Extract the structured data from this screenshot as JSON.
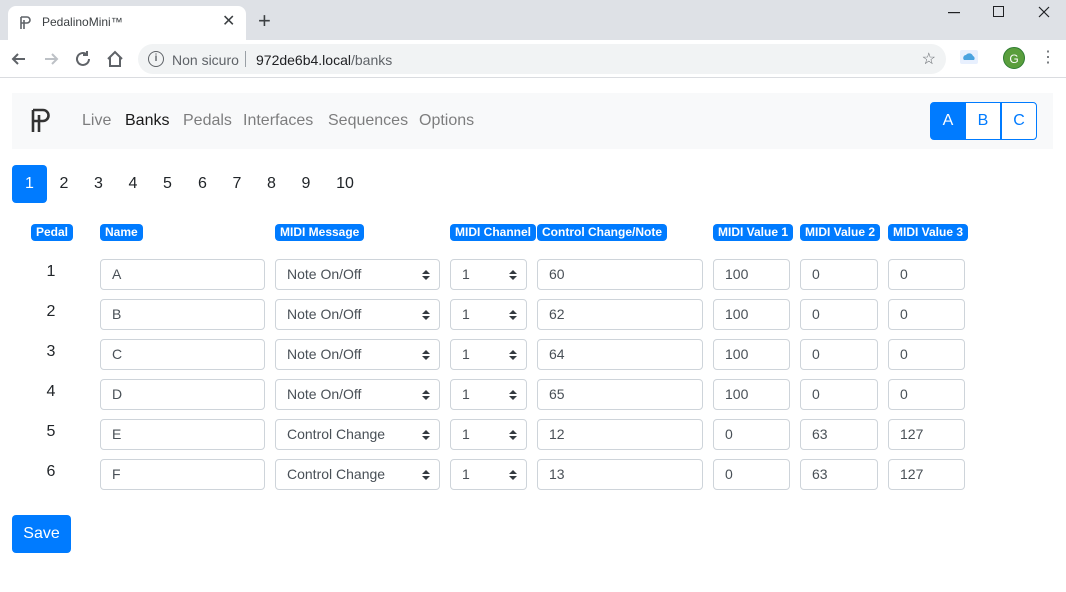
{
  "browser": {
    "tab_title": "PedalinoMini™",
    "newtab": "+",
    "close": "✕",
    "security": "Non sicuro",
    "url_host": "972de6b4.local",
    "url_path": "/banks",
    "avatar_letter": "G"
  },
  "nav": {
    "links": [
      "Live",
      "Banks",
      "Pedals",
      "Interfaces",
      "Sequences",
      "Options"
    ],
    "active_link": "Banks",
    "banks": [
      "A",
      "B",
      "C"
    ],
    "active_bank": "A"
  },
  "pagination": [
    "1",
    "2",
    "3",
    "4",
    "5",
    "6",
    "7",
    "8",
    "9",
    "10"
  ],
  "table": {
    "headers": {
      "pedal": "Pedal",
      "name": "Name",
      "message": "MIDI Message",
      "channel": "MIDI Channel",
      "cc": "Control Change/Note",
      "v1": "MIDI Value 1",
      "v2": "MIDI Value 2",
      "v3": "MIDI Value 3"
    },
    "rows": [
      {
        "pedal": "1",
        "name": "A",
        "message": "Note On/Off",
        "channel": "1",
        "cc": "60",
        "v1": "100",
        "v2": "0",
        "v3": "0"
      },
      {
        "pedal": "2",
        "name": "B",
        "message": "Note On/Off",
        "channel": "1",
        "cc": "62",
        "v1": "100",
        "v2": "0",
        "v3": "0"
      },
      {
        "pedal": "3",
        "name": "C",
        "message": "Note On/Off",
        "channel": "1",
        "cc": "64",
        "v1": "100",
        "v2": "0",
        "v3": "0"
      },
      {
        "pedal": "4",
        "name": "D",
        "message": "Note On/Off",
        "channel": "1",
        "cc": "65",
        "v1": "100",
        "v2": "0",
        "v3": "0"
      },
      {
        "pedal": "5",
        "name": "E",
        "message": "Control Change",
        "channel": "1",
        "cc": "12",
        "v1": "0",
        "v2": "63",
        "v3": "127"
      },
      {
        "pedal": "6",
        "name": "F",
        "message": "Control Change",
        "channel": "1",
        "cc": "13",
        "v1": "0",
        "v2": "63",
        "v3": "127"
      }
    ]
  },
  "save_label": "Save",
  "colors": {
    "primary": "#007bff",
    "navbar_bg": "#f8f9fa",
    "chrome_bg": "#dee1e6"
  }
}
